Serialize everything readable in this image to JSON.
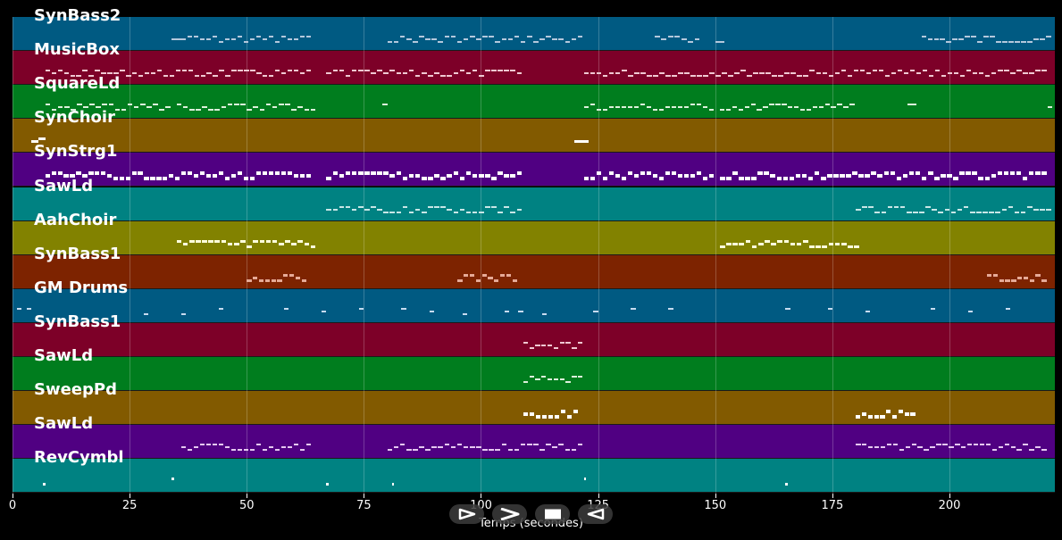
{
  "tracks": [
    {
      "name": "SynBass2",
      "color": "#005a82",
      "note_color": "#b4c8dc",
      "thick": 2,
      "notes": [
        [
          34,
          36
        ],
        [
          36,
          64
        ],
        [
          80,
          122
        ],
        [
          137,
          147
        ],
        [
          150,
          152
        ],
        [
          194,
          222
        ]
      ]
    },
    {
      "name": "MusicBox",
      "color": "#7d0028",
      "note_color": "#f0c8d2",
      "thick": 2,
      "notes": [
        [
          7,
          64
        ],
        [
          67,
          109
        ],
        [
          122,
          221
        ]
      ]
    },
    {
      "name": "SquareLd",
      "color": "#007d1e",
      "note_color": "#dcf0dc",
      "thick": 2,
      "notes": [
        [
          7,
          34
        ],
        [
          35,
          65
        ],
        [
          79,
          80
        ],
        [
          122,
          150
        ],
        [
          151,
          180
        ],
        [
          191,
          193
        ],
        [
          221,
          222
        ]
      ]
    },
    {
      "name": "SynChoir",
      "color": "#825a00",
      "note_color": "#ffffff",
      "thick": 3,
      "notes": [
        [
          4,
          7
        ],
        [
          120,
          123
        ]
      ]
    },
    {
      "name": "SynStrg1",
      "color": "#500082",
      "note_color": "#ffffff",
      "thick": 4,
      "notes": [
        [
          7,
          36
        ],
        [
          36,
          64
        ],
        [
          67,
          109
        ],
        [
          122,
          150
        ],
        [
          151,
          221
        ]
      ]
    },
    {
      "name": "SawLd",
      "color": "#008282",
      "note_color": "#c8e6e6",
      "thick": 2,
      "notes": [
        [
          67,
          109
        ],
        [
          180,
          222
        ]
      ]
    },
    {
      "name": "AahChoir",
      "color": "#828200",
      "note_color": "#ffffdc",
      "thick": 3,
      "notes": [
        [
          35,
          65
        ],
        [
          151,
          181
        ]
      ]
    },
    {
      "name": "SynBass1",
      "color": "#7d2300",
      "note_color": "#e6aa96",
      "thick": 3,
      "notes": [
        [
          50,
          63
        ],
        [
          95,
          108
        ],
        [
          208,
          221
        ]
      ]
    },
    {
      "name": "GM Drums",
      "color": "#005a82",
      "note_color": "#c8dcf0",
      "thick": 2,
      "notes": [
        [
          1,
          2
        ],
        [
          3,
          4
        ],
        [
          28,
          29
        ],
        [
          36,
          37
        ],
        [
          44,
          45
        ],
        [
          58,
          59
        ],
        [
          66,
          67
        ],
        [
          74,
          75
        ],
        [
          83,
          84
        ],
        [
          89,
          90
        ],
        [
          96,
          97
        ],
        [
          105,
          106
        ],
        [
          108,
          109
        ],
        [
          113,
          114
        ],
        [
          124,
          125
        ],
        [
          132,
          133
        ],
        [
          140,
          141
        ],
        [
          165,
          166
        ],
        [
          174,
          175
        ],
        [
          182,
          183
        ],
        [
          196,
          197
        ],
        [
          204,
          205
        ],
        [
          212,
          213
        ]
      ]
    },
    {
      "name": "SynBass1",
      "color": "#7d0028",
      "note_color": "#f0c8d2",
      "thick": 2,
      "notes": [
        [
          109,
          122
        ]
      ]
    },
    {
      "name": "SawLd",
      "color": "#007d1e",
      "note_color": "#dcf0dc",
      "thick": 2,
      "notes": [
        [
          109,
          122
        ]
      ]
    },
    {
      "name": "SweepPd",
      "color": "#825a00",
      "note_color": "#ffffff",
      "thick": 4,
      "notes": [
        [
          109,
          121
        ],
        [
          180,
          193
        ]
      ]
    },
    {
      "name": "SawLd",
      "color": "#500082",
      "note_color": "#e6c8f0",
      "thick": 2,
      "notes": [
        [
          36,
          64
        ],
        [
          80,
          122
        ],
        [
          180,
          221
        ]
      ]
    },
    {
      "name": "RevCymbl",
      "color": "#008282",
      "note_color": "#ffffff",
      "thick": 3,
      "notes": [
        [
          6.5,
          7
        ],
        [
          34,
          34.5
        ],
        [
          67,
          67.5
        ],
        [
          81,
          81.5
        ],
        [
          122,
          122.5
        ],
        [
          165,
          165.5
        ]
      ]
    }
  ],
  "x_axis": {
    "label": "Temps (secondes)",
    "min": 0,
    "max": 222.5,
    "ticks": [
      0,
      25,
      50,
      75,
      100,
      125,
      150,
      175,
      200
    ],
    "tick_labels": [
      "0",
      "25",
      "50",
      "75",
      "100",
      "125",
      "150",
      "175",
      "200"
    ]
  },
  "controls": [
    {
      "name": "play-icon",
      "label": "Play"
    },
    {
      "name": "fast-forward-icon",
      "label": "Fast forward"
    },
    {
      "name": "stop-icon",
      "label": "Stop"
    },
    {
      "name": "rewind-icon",
      "label": "Rewind"
    }
  ]
}
